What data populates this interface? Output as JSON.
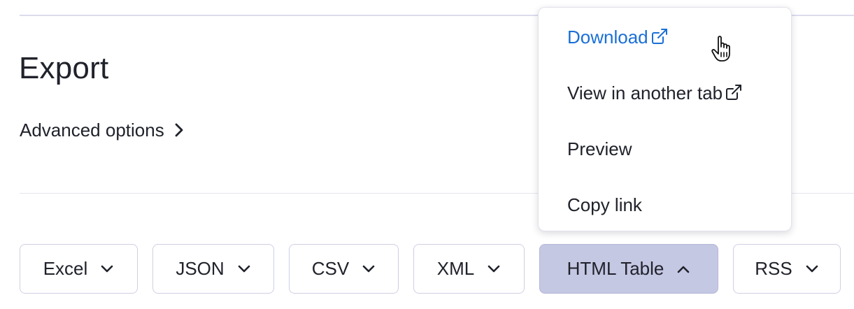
{
  "page": {
    "title": "Export",
    "advanced_options_label": "Advanced options"
  },
  "formats": [
    {
      "label": "Excel",
      "expanded": false
    },
    {
      "label": "JSON",
      "expanded": false
    },
    {
      "label": "CSV",
      "expanded": false
    },
    {
      "label": "XML",
      "expanded": false
    },
    {
      "label": "HTML Table",
      "expanded": true
    },
    {
      "label": "RSS",
      "expanded": false
    }
  ],
  "menu": {
    "items": [
      {
        "label": "Download",
        "icon": "external-link-icon"
      },
      {
        "label": "View in another tab",
        "icon": "external-link-icon"
      },
      {
        "label": "Preview"
      },
      {
        "label": "Copy link"
      }
    ]
  },
  "colors": {
    "text": "#20222b",
    "link": "#1a6fd6",
    "active_button_bg": "#c5c8e3",
    "button_border": "#cfd0e4"
  }
}
